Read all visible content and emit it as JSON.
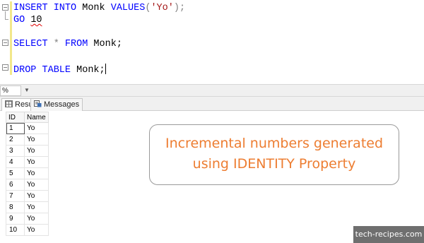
{
  "editor": {
    "line1": {
      "kw1": "INSERT INTO",
      "ident": " Monk ",
      "kw2": "VALUES",
      "open": "(",
      "str": "'Yo'",
      "close": ");"
    },
    "line2": {
      "kw": "GO",
      "space": " ",
      "num": "10"
    },
    "line3": {
      "kw1": "SELECT",
      "star": " * ",
      "kw2": "FROM",
      "ident": " Monk;"
    },
    "line4": {
      "kw": "DROP TABLE",
      "ident": " Monk;"
    }
  },
  "zoom": {
    "value": "%",
    "arrow_icon": "chevron-down-icon"
  },
  "tabs": [
    {
      "label": "Results",
      "icon": "grid-icon"
    },
    {
      "label": "Messages",
      "icon": "messages-icon"
    }
  ],
  "grid": {
    "columns": [
      "ID",
      "Name"
    ],
    "rows": [
      [
        "1",
        "Yo"
      ],
      [
        "2",
        "Yo"
      ],
      [
        "3",
        "Yo"
      ],
      [
        "4",
        "Yo"
      ],
      [
        "5",
        "Yo"
      ],
      [
        "6",
        "Yo"
      ],
      [
        "7",
        "Yo"
      ],
      [
        "8",
        "Yo"
      ],
      [
        "9",
        "Yo"
      ],
      [
        "10",
        "Yo"
      ]
    ]
  },
  "callout": {
    "line1": "Incremental numbers generated",
    "line2": "using IDENTITY Property",
    "color": "#ed7d31"
  },
  "watermark": "tech-recipes.com"
}
